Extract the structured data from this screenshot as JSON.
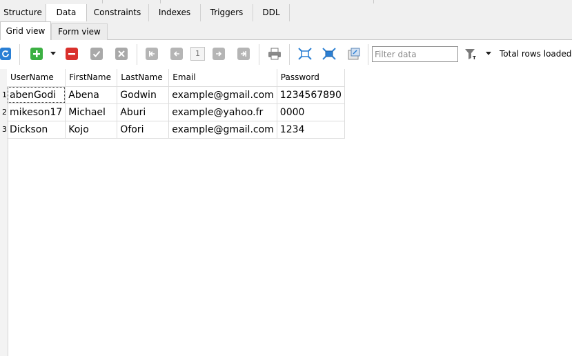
{
  "top_tabs": [
    {
      "label": "Structure",
      "active": false
    },
    {
      "label": "Data",
      "active": true
    },
    {
      "label": "Constraints",
      "active": false
    },
    {
      "label": "Indexes",
      "active": false
    },
    {
      "label": "Triggers",
      "active": false
    },
    {
      "label": "DDL",
      "active": false
    }
  ],
  "view_tabs": [
    {
      "label": "Grid view",
      "active": true
    },
    {
      "label": "Form view",
      "active": false
    }
  ],
  "toolbar": {
    "page_number": "1",
    "filter_placeholder": "Filter data",
    "total_rows_label": "Total rows loaded:",
    "icons": [
      "refresh-icon",
      "insert-row-icon",
      "insert-dropdown-icon",
      "delete-row-icon",
      "commit-icon",
      "rollback-icon",
      "first-page-icon",
      "previous-page-icon",
      "next-page-icon",
      "last-page-icon",
      "print-icon",
      "fit-columns-icon",
      "fit-columns-data-icon",
      "export-icon",
      "filter-icon",
      "filter-dropdown-icon"
    ]
  },
  "grid": {
    "columns": [
      "UserName",
      "FirstName",
      "LastName",
      "Email",
      "Password"
    ],
    "row_numbers": [
      "1",
      "2",
      "3"
    ],
    "rows": [
      [
        "abenGodi",
        "Abena",
        "Godwin",
        "example@gmail.com",
        "1234567890"
      ],
      [
        "mikeson17",
        "Michael",
        "Aburi",
        "example@yahoo.fr",
        "0000"
      ],
      [
        "Dickson",
        "Kojo",
        "Ofori",
        "example@gmail.com",
        "1234"
      ]
    ]
  },
  "colors": {
    "accent_blue": "#2a7fd4",
    "add_green": "#3cb043",
    "delete_red": "#d9302c",
    "disabled_gray": "#a9a9a9"
  }
}
